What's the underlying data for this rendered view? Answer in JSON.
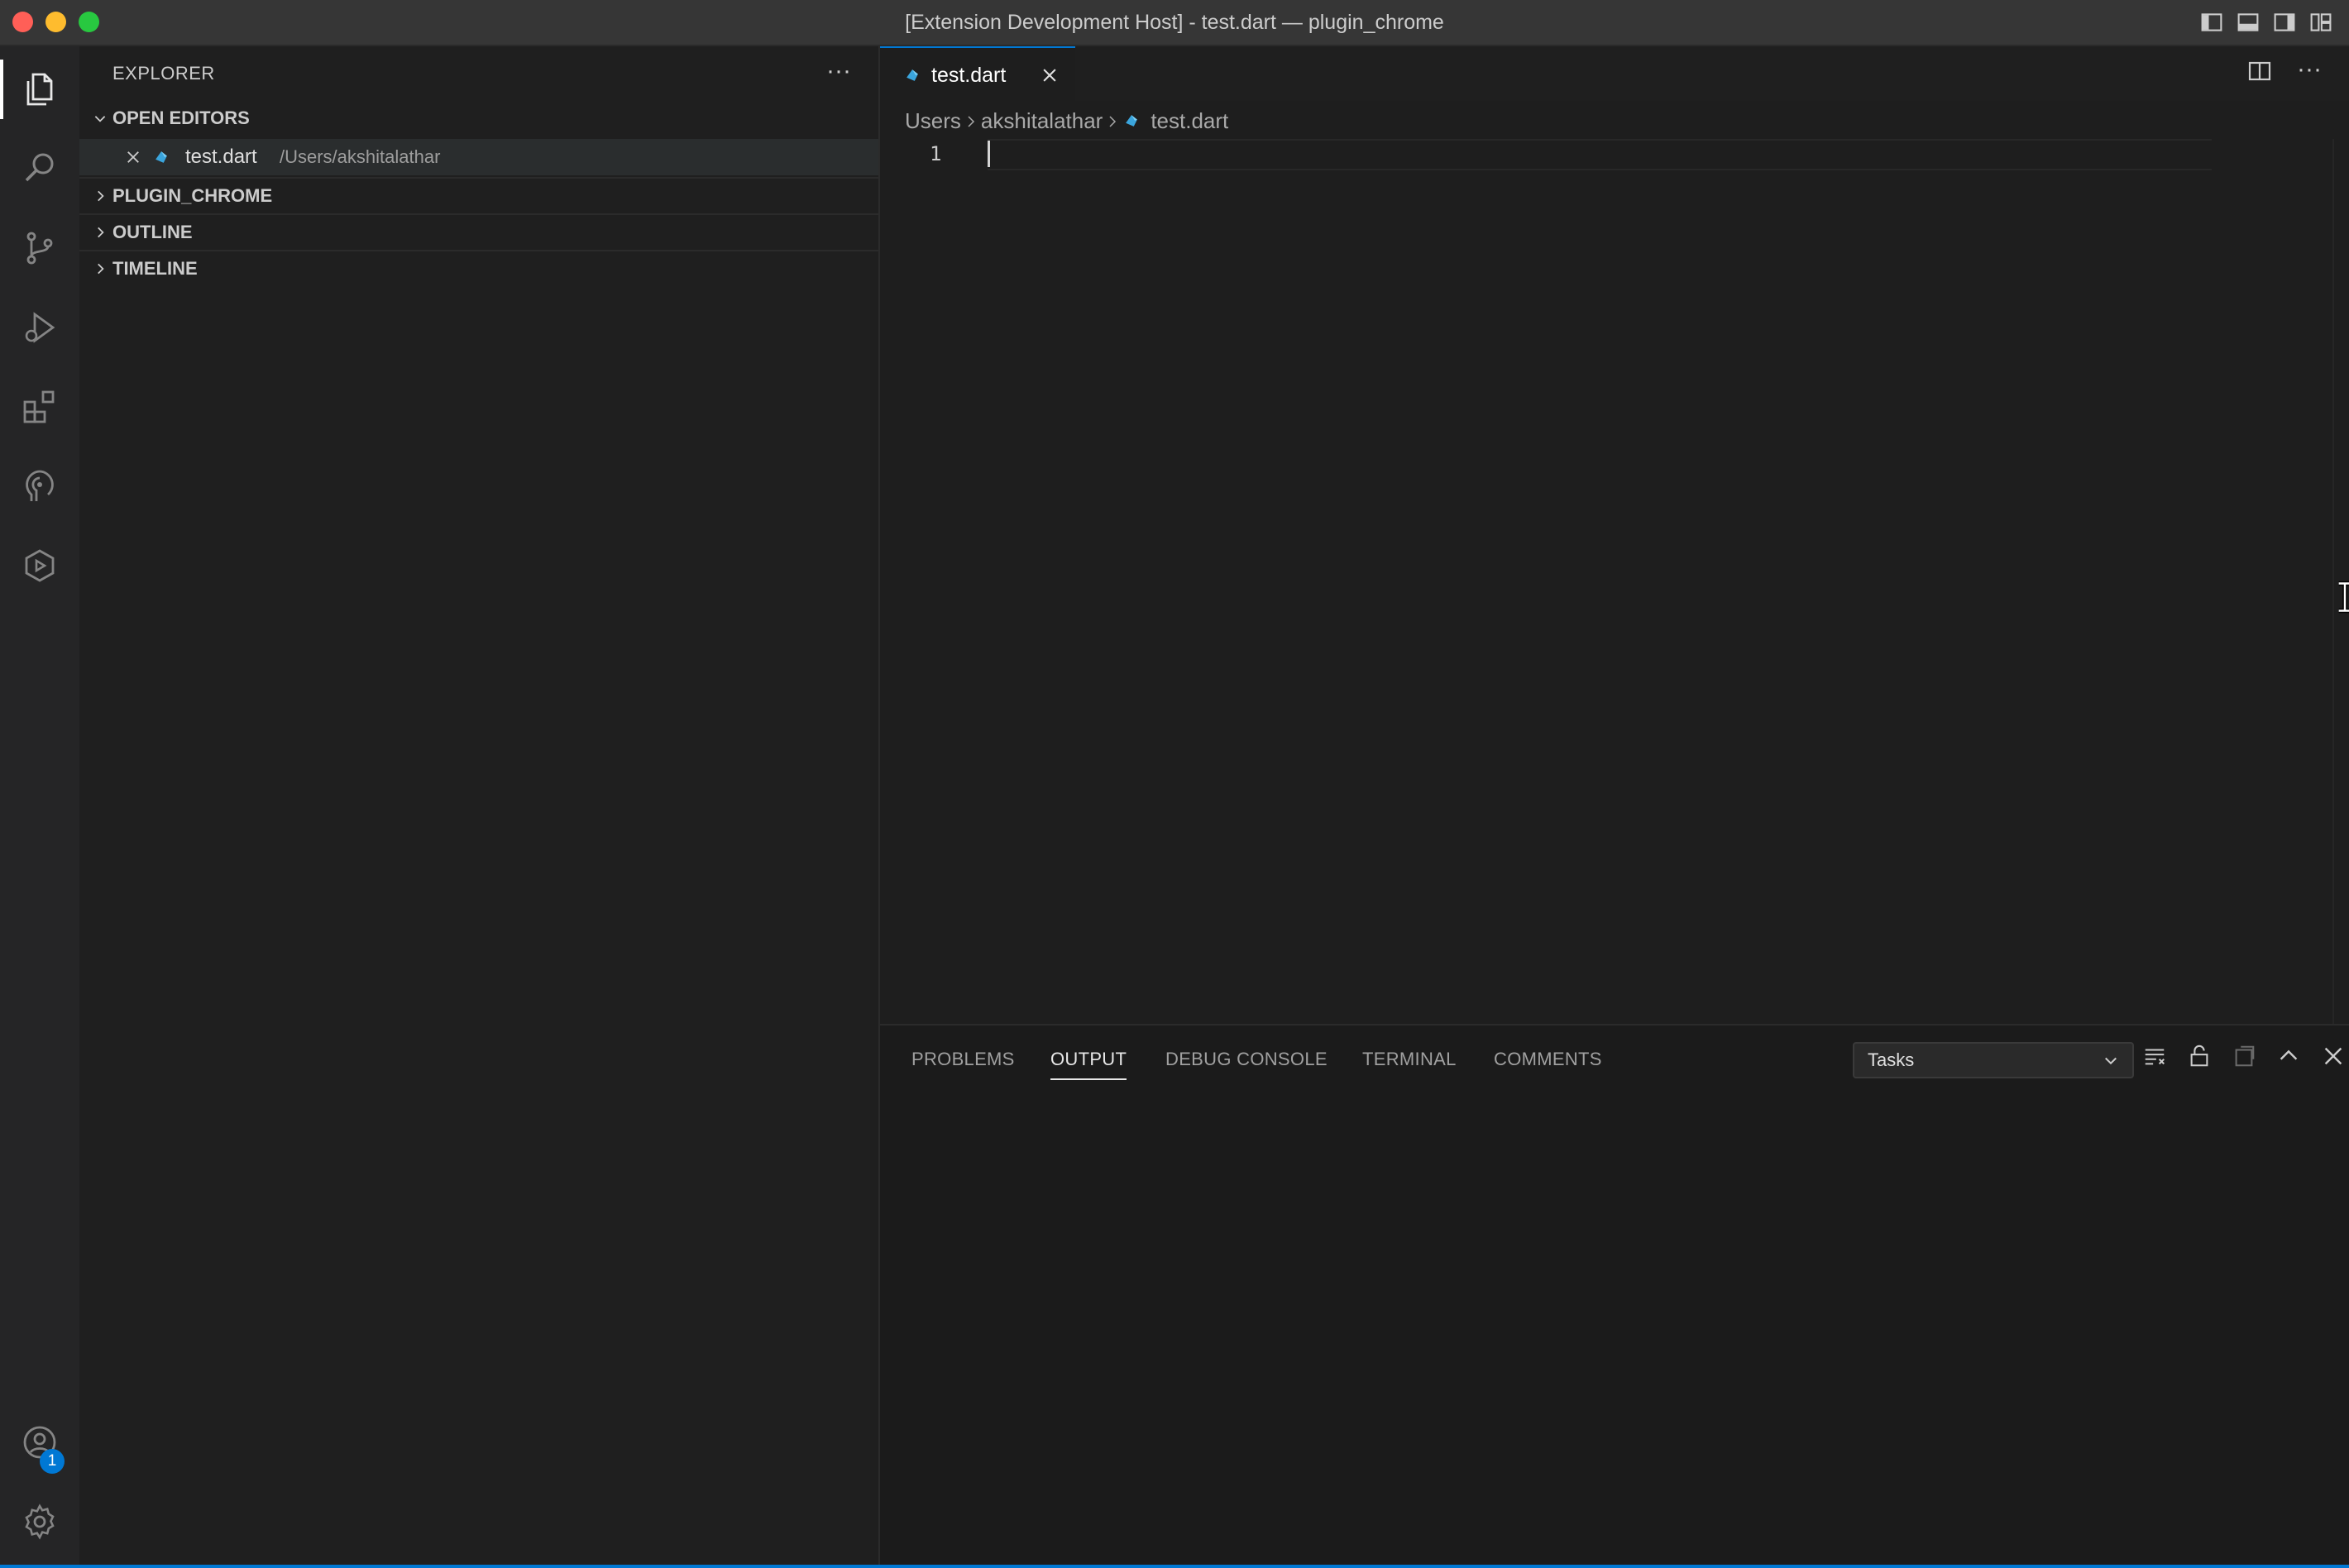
{
  "window": {
    "title": "[Extension Development Host] - test.dart — plugin_chrome"
  },
  "activity_bar": {
    "items": [
      "explorer-icon",
      "search-icon",
      "source-control-icon",
      "run-debug-icon",
      "extensions-icon",
      "remote-icon",
      "test-icon"
    ],
    "accounts_badge": "1"
  },
  "sidebar": {
    "title": "EXPLORER",
    "more": "···",
    "sections": {
      "open_editors": "OPEN EDITORS",
      "plugin_chrome": "PLUGIN_CHROME",
      "outline": "OUTLINE",
      "timeline": "TIMELINE"
    },
    "open_editor": {
      "name": "test.dart",
      "path": "/Users/akshitalathar"
    }
  },
  "editor": {
    "tab_label": "test.dart",
    "breadcrumb": [
      "Users",
      "akshitalathar",
      "test.dart"
    ],
    "line_number": "1",
    "more": "···"
  },
  "panel": {
    "tabs": [
      "PROBLEMS",
      "OUTPUT",
      "DEBUG CONSOLE",
      "TERMINAL",
      "COMMENTS"
    ],
    "active_tab": "OUTPUT",
    "output_channel": "Tasks"
  },
  "colors": {
    "accent": "#0078d4",
    "dart_icon": "#3aa5dd"
  }
}
